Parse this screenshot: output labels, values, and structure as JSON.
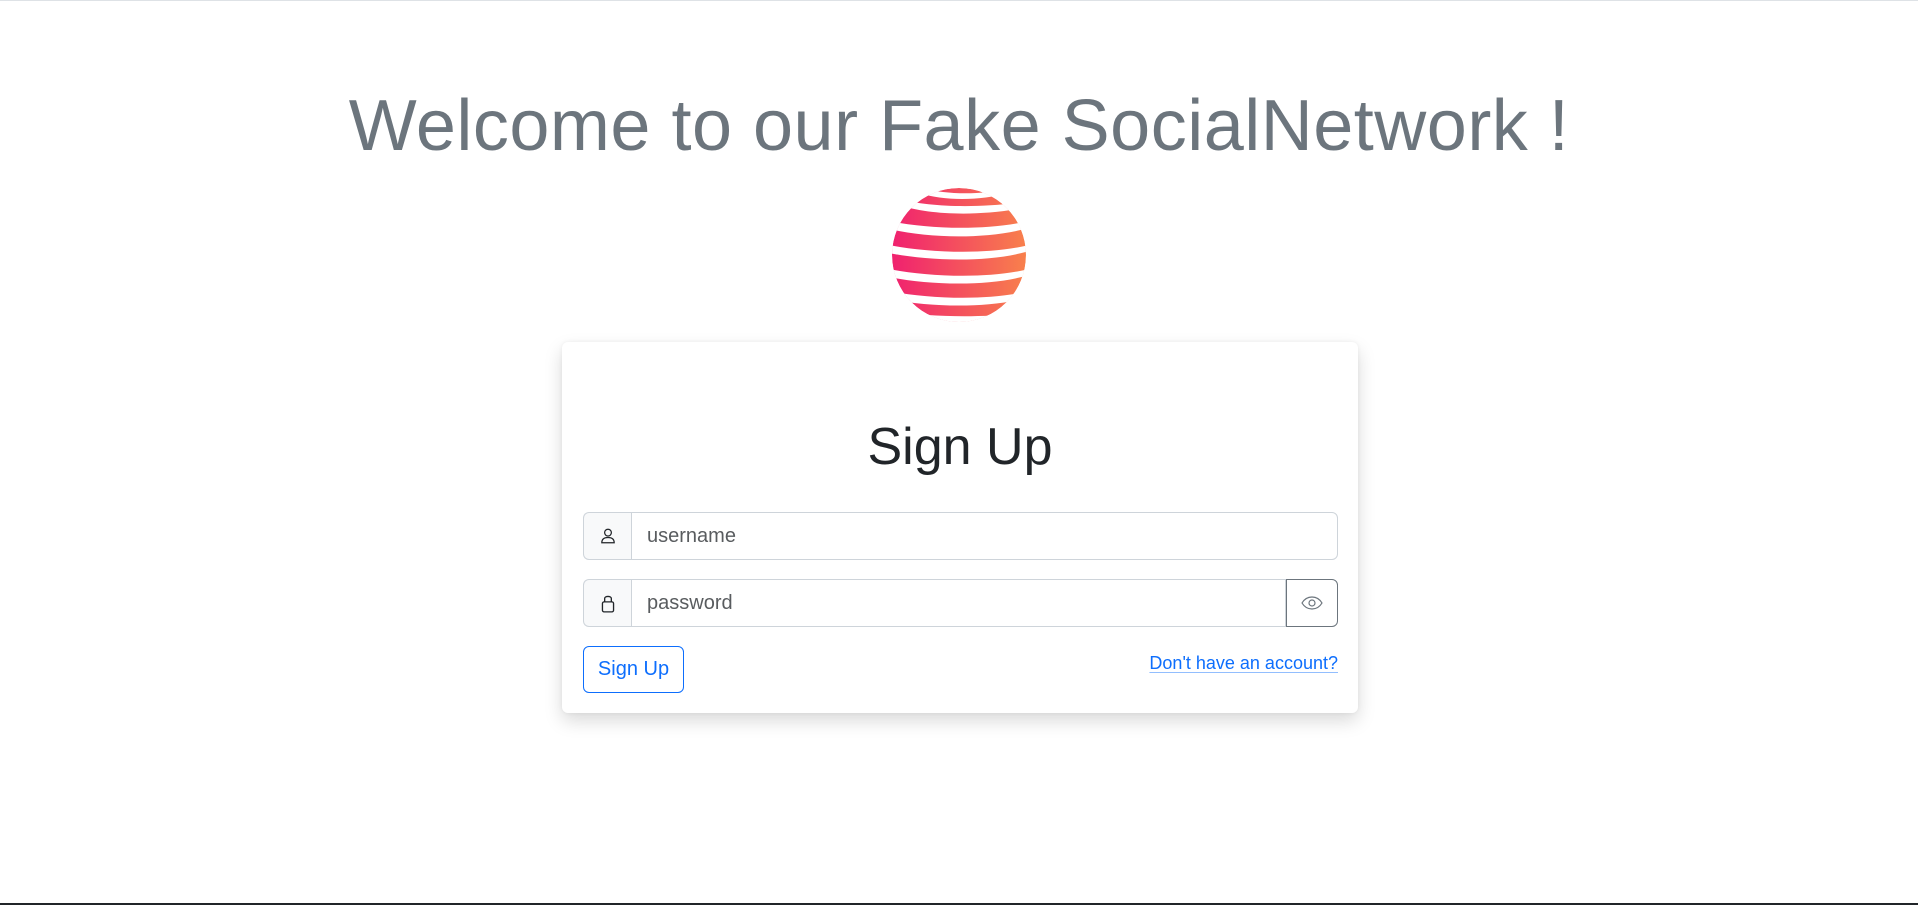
{
  "header": {
    "welcome_text": "Welcome to our Fake SocialNetwork !"
  },
  "logo": {
    "icon": "striped-globe-logo",
    "gradient_start": "#f0216f",
    "gradient_end": "#f8804c"
  },
  "form": {
    "title": "Sign Up",
    "username": {
      "icon": "user-icon",
      "placeholder": "username",
      "value": ""
    },
    "password": {
      "icon": "lock-icon",
      "placeholder": "password",
      "value": "",
      "toggle_icon": "eye-icon"
    },
    "submit_label": "Sign Up",
    "account_link": "Don't have an account?"
  },
  "colors": {
    "primary": "#0d6efd",
    "muted_text": "#6c757d",
    "heading_text": "#212529",
    "border": "#ced4da"
  }
}
